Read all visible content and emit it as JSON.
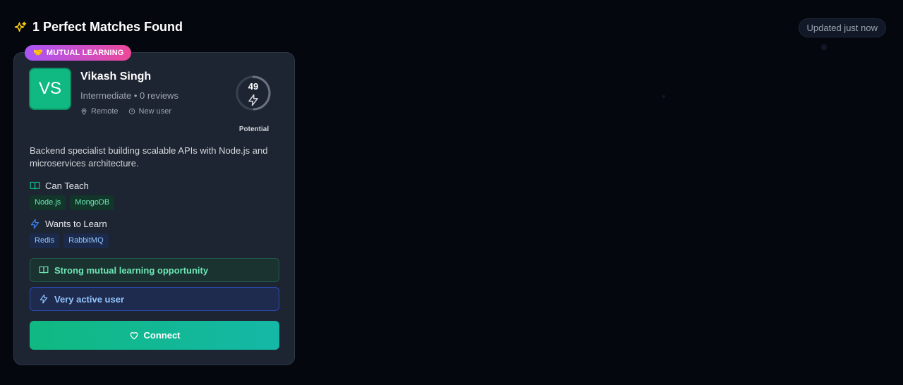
{
  "header": {
    "title": "1 Perfect Matches Found",
    "updated": "Updated just now"
  },
  "card": {
    "badge": "MUTUAL LEARNING",
    "avatar_initials": "VS",
    "name": "Vikash Singh",
    "meta": "Intermediate • 0 reviews",
    "location": "Remote",
    "tenure": "New user",
    "score": "49",
    "score_label": "Potential",
    "bio": "Backend specialist building scalable APIs with Node.js and microservices architecture.",
    "can_teach_title": "Can Teach",
    "can_teach": [
      "Node.js",
      "MongoDB"
    ],
    "wants_learn_title": "Wants to Learn",
    "wants_learn": [
      "Redis",
      "RabbitMQ"
    ],
    "insights": [
      "Strong mutual learning opportunity",
      "Very active user"
    ],
    "connect_label": "Connect"
  },
  "colors": {
    "accent_green": "#10b981",
    "accent_blue": "#3b82f6",
    "badge_gradient_start": "#a855f7",
    "badge_gradient_end": "#ec4899"
  },
  "icons": [
    "sparkles-icon",
    "handshake-icon",
    "map-pin-icon",
    "clock-icon",
    "zap-icon",
    "book-open-icon",
    "heart-icon"
  ]
}
